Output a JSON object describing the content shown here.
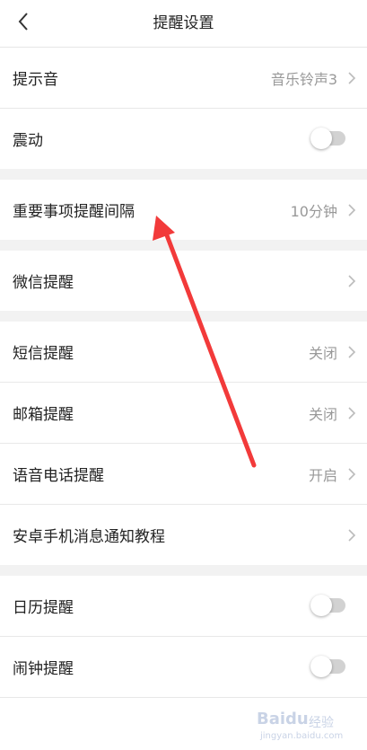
{
  "header": {
    "title": "提醒设置",
    "back_icon": "chevron-left-icon"
  },
  "rows": {
    "tone": {
      "label": "提示音",
      "value": "音乐铃声3"
    },
    "vibrate": {
      "label": "震动",
      "toggle_on": false
    },
    "important_interval": {
      "label": "重要事项提醒间隔",
      "value": "10分钟"
    },
    "wechat": {
      "label": "微信提醒"
    },
    "sms": {
      "label": "短信提醒",
      "value": "关闭"
    },
    "mail": {
      "label": "邮箱提醒",
      "value": "关闭"
    },
    "voice_call": {
      "label": "语音电话提醒",
      "value": "开启"
    },
    "android_tutorial": {
      "label": "安卓手机消息通知教程"
    },
    "calendar": {
      "label": "日历提醒",
      "toggle_on": false
    },
    "alarm": {
      "label": "闹钟提醒",
      "toggle_on": false
    }
  },
  "annotation": {
    "color": "#f23a3a"
  },
  "watermark": {
    "brand": "Baidu",
    "sub": "经验",
    "url": "jingyan.baidu.com"
  },
  "colors": {
    "gap": "#f2f2f2",
    "value_text": "#999999",
    "toggle_off": "#d2d2d2"
  }
}
